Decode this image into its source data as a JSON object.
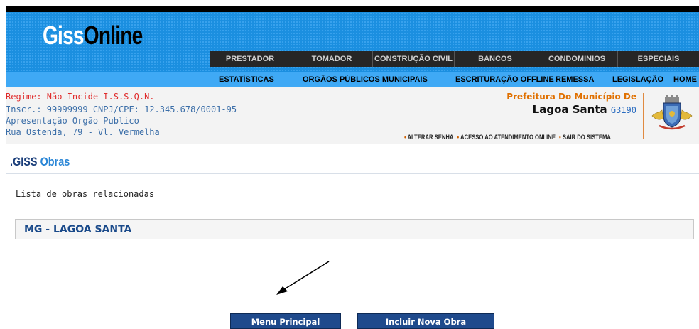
{
  "logo": {
    "part1": "Giss",
    "part2": "Online"
  },
  "nav_primary": [
    "PRESTADOR",
    "TOMADOR",
    "CONSTRUÇÃO CIVIL",
    "BANCOS",
    "CONDOMINIOS",
    "ESPECIAIS"
  ],
  "nav_secondary": [
    "ESTATÍSTICAS",
    "ORGÃOS PÚBLICOS MUNICIPAIS",
    "ESCRITURAÇÃO OFFLINE",
    "REMESSA",
    "LEGISLAÇÃO",
    "HOME"
  ],
  "user_info": {
    "regime": "Regime: Não Incide I.S.S.Q.N.",
    "inscricao": "Inscr.: 99999999  CNPJ/CPF: 12.345.678/0001-95",
    "nome": "Apresentação Orgão Publico",
    "endereco": "Rua Ostenda, 79 - Vl. Vermelha"
  },
  "prefeitura": {
    "line1": "Prefeitura Do Município De",
    "city": "Lagoa Santa",
    "code": "G3190"
  },
  "account_links": [
    "ALTERAR SENHA",
    "ACESSO AO ATENDIMENTO ONLINE",
    "SAIR DO SISTEMA"
  ],
  "section": {
    "title_a": ".GISS",
    "title_b": " Obras"
  },
  "list_label": "Lista de obras relacionadas",
  "obras": [
    "MG - LAGOA SANTA"
  ],
  "buttons": {
    "menu_principal": "Menu Principal",
    "incluir_obra": "Incluir Nova Obra"
  },
  "colors": {
    "header_blue": "#1b8fe0",
    "nav_dark": "#262626",
    "button_blue": "#1f4a8c",
    "regime_red": "#e02b2b"
  }
}
